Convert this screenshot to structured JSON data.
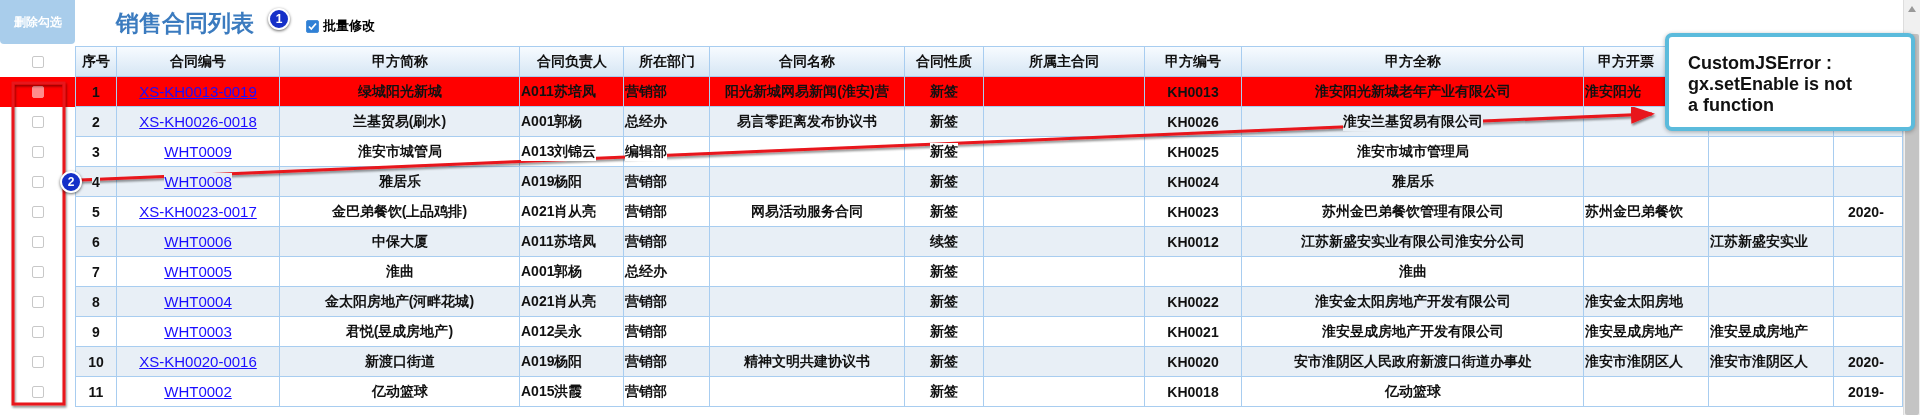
{
  "toolbar": {
    "delete_button": "删除勾选",
    "title": "销售合同列表",
    "batch_edit": {
      "label": "批量修改",
      "checked": true
    }
  },
  "table": {
    "select_all": {
      "checked": false
    },
    "columns": [
      "序号",
      "合同编号",
      "甲方简称",
      "合同负责人",
      "所在部门",
      "合同名称",
      "合同性质",
      "所属主合同",
      "甲方编号",
      "甲方全称",
      "甲方开票"
    ],
    "rows": [
      {
        "selected": true,
        "checked": false,
        "no": "1",
        "contract_no": "XS-KH0013-0019",
        "party_short": "绿城阳光新城",
        "manager": "A011苏培凤",
        "department": "营销部",
        "contract_name": "阳光新城网易新闻(淮安)营",
        "nature": "新签",
        "party_code": "KH0013",
        "party_full": "淮安阳光新城老年产业有限公司",
        "column_11": "淮安阳光"
      },
      {
        "selected": false,
        "checked": false,
        "no": "2",
        "contract_no": "XS-KH0026-0018",
        "party_short": "兰基贸易(刷水)",
        "manager": "A001郭杨",
        "department": "总经办",
        "contract_name": "易言零距离发布协议书",
        "nature": "新签",
        "party_code": "KH0026",
        "party_full": "淮安兰基贸易有限公司"
      },
      {
        "selected": false,
        "checked": false,
        "no": "3",
        "contract_no": "WHT0009",
        "party_short": "淮安市城管局",
        "manager": "A013刘锦云",
        "department": "编辑部",
        "nature": "新签",
        "party_code": "KH0025",
        "party_full": "淮安市城市管理局"
      },
      {
        "selected": false,
        "checked": false,
        "no": "4",
        "contract_no": "WHT0008",
        "party_short": "雅居乐",
        "manager": "A019杨阳",
        "department": "营销部",
        "nature": "新签",
        "party_code": "KH0024",
        "party_full": "雅居乐"
      },
      {
        "selected": false,
        "checked": false,
        "no": "5",
        "contract_no": "XS-KH0023-0017",
        "party_short": "金巴弟餐饮(上品鸡排)",
        "manager": "A021肖从亮",
        "department": "营销部",
        "contract_name": "网易活动服务合同",
        "nature": "新签",
        "party_code": "KH0023",
        "party_full": "苏州金巴弟餐饮管理有限公司",
        "column_11": "苏州金巴弟餐饮",
        "column_13": "2020-"
      },
      {
        "selected": false,
        "checked": false,
        "no": "6",
        "contract_no": "WHT0006",
        "party_short": "中保大厦",
        "manager": "A011苏培凤",
        "department": "营销部",
        "nature": "续签",
        "party_code": "KH0012",
        "party_full": "江苏新盛安实业有限公司淮安分公司",
        "column_12": "江苏新盛安实业"
      },
      {
        "selected": false,
        "checked": false,
        "no": "7",
        "contract_no": "WHT0005",
        "party_short": "淮曲",
        "manager": "A001郭杨",
        "department": "总经办",
        "nature": "新签",
        "party_full": "淮曲"
      },
      {
        "selected": false,
        "checked": false,
        "no": "8",
        "contract_no": "WHT0004",
        "party_short": "金太阳房地产(河畔花城)",
        "manager": "A021肖从亮",
        "department": "营销部",
        "nature": "新签",
        "party_code": "KH0022",
        "party_full": "淮安金太阳房地产开发有限公司",
        "column_11": "淮安金太阳房地"
      },
      {
        "selected": false,
        "checked": false,
        "no": "9",
        "contract_no": "WHT0003",
        "party_short": "君悦(昱成房地产)",
        "manager": "A012吴永",
        "department": "营销部",
        "nature": "新签",
        "party_code": "KH0021",
        "party_full": "淮安昱成房地产开发有限公司",
        "column_11": "淮安昱成房地产",
        "column_12": "淮安昱成房地产"
      },
      {
        "selected": false,
        "checked": false,
        "no": "10",
        "contract_no": "XS-KH0020-0016",
        "party_short": "新渡口街道",
        "manager": "A019杨阳",
        "department": "营销部",
        "contract_name": "精神文明共建协议书",
        "nature": "新签",
        "party_code": "KH0020",
        "party_full": "安市淮阴区人民政府新渡口街道办事处",
        "column_11": "淮安市淮阴区人",
        "column_12": "淮安市淮阴区人",
        "column_13": "2020-"
      },
      {
        "selected": false,
        "checked": false,
        "no": "11",
        "contract_no": "WHT0002",
        "party_short": "亿动篮球",
        "manager": "A015洪霞",
        "department": "营销部",
        "nature": "新签",
        "party_code": "KH0018",
        "party_full": "亿动篮球",
        "column_13": "2019-"
      }
    ]
  },
  "annotations": [
    {
      "badge": "1"
    },
    {
      "badge": "2"
    }
  ],
  "error_tooltip": {
    "message": "CustomJSError :\ngx.setEnable is not\na function"
  }
}
